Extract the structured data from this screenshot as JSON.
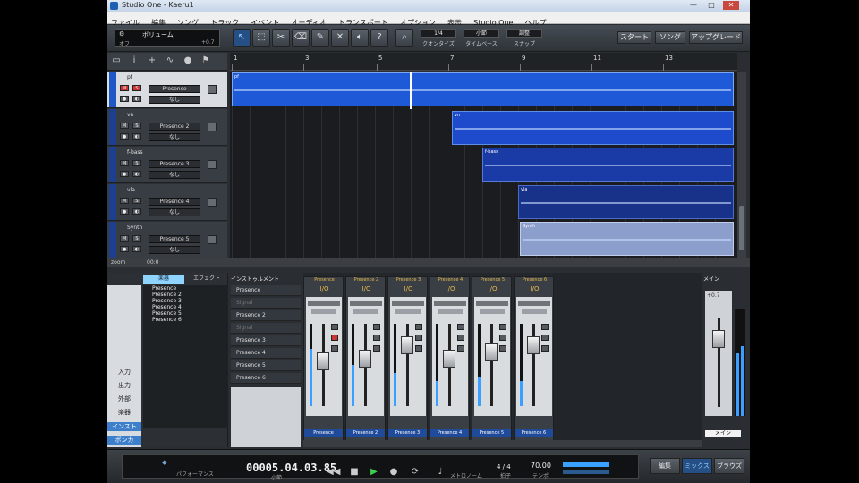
{
  "window": {
    "title": "Studio One - Kaeru1",
    "controls": [
      "—",
      "□",
      "✕"
    ]
  },
  "menu": [
    "ファイル",
    "編集",
    "ソング",
    "トラック",
    "イベント",
    "オーディオ",
    "トランスポート",
    "オプション",
    "表示",
    "Studio One",
    "ヘルプ"
  ],
  "toolbar": {
    "volume_label": "ボリューム",
    "volume_sub": "オフ",
    "volume_value": "+0.7",
    "tools": [
      "arrow-tool",
      "range-tool",
      "split-tool",
      "eraser-tool",
      "paint-tool",
      "mute-tool",
      "listen-tool",
      "help-tool",
      "zoom-tool"
    ],
    "grid": [
      {
        "value": "1/4",
        "label": "クオンタイズ"
      },
      {
        "value": "小節",
        "label": "タイムベース"
      },
      {
        "value": "調整",
        "label": "スナップ"
      }
    ],
    "start_label": "スタート",
    "song_label": "ソング",
    "upgrade_label": "アップグレード"
  },
  "ruler": {
    "bars": [
      "1",
      "3",
      "5",
      "7",
      "9",
      "11",
      "13"
    ]
  },
  "tracks": [
    {
      "name": "pf",
      "instrument": "Presence",
      "output": "なし",
      "selected": true
    },
    {
      "name": "vn",
      "instrument": "Presence 2",
      "output": "なし",
      "selected": false
    },
    {
      "name": "f-bass",
      "instrument": "Presence 3",
      "output": "なし",
      "selected": false
    },
    {
      "name": "vla",
      "instrument": "Presence 4",
      "output": "なし",
      "selected": false
    },
    {
      "name": "Synth",
      "instrument": "Presence 5",
      "output": "なし",
      "selected": false
    }
  ],
  "clips": [
    {
      "name": "pf"
    },
    {
      "name": "vn"
    },
    {
      "name": "f-bass"
    },
    {
      "name": "vla"
    },
    {
      "name": "Synth"
    }
  ],
  "arrange_bottom": {
    "zoom_label": "zoom",
    "info": "00:0"
  },
  "browser": {
    "tabs": [
      "楽器",
      "エフェクト"
    ],
    "side": [
      "入力",
      "出力",
      "外部",
      "楽器",
      "インスト",
      "ボンカ"
    ],
    "items": [
      "Presence",
      "Presence 2",
      "Presence 3",
      "Presence 4",
      "Presence 5",
      "Presence 6"
    ],
    "bottom_tabs": [
      "",
      "楽器",
      "ソ"
    ]
  },
  "instrument_list": {
    "header": "インストゥルメント",
    "rows": [
      {
        "label": "Presence",
        "ghost": false
      },
      {
        "label": "Signal",
        "ghost": true
      },
      {
        "label": "Presence 2",
        "ghost": false
      },
      {
        "label": "Signal",
        "ghost": true
      },
      {
        "label": "Presence 3",
        "ghost": false
      },
      {
        "label": "Presence 4",
        "ghost": false
      },
      {
        "label": "Presence 5",
        "ghost": false
      },
      {
        "label": "Presence 6",
        "ghost": false
      }
    ]
  },
  "mixer": {
    "channels": [
      {
        "name": "Presence",
        "io": "I/O",
        "label": "Presence",
        "fader": 0.55,
        "meter": 0.7
      },
      {
        "name": "Presence 2",
        "io": "I/O",
        "label": "Presence 2",
        "fader": 0.6,
        "meter": 0.5
      },
      {
        "name": "Presence 3",
        "io": "I/O",
        "label": "Presence 3",
        "fader": 0.8,
        "meter": 0.4
      },
      {
        "name": "Presence 4",
        "io": "I/O",
        "label": "Presence 4",
        "fader": 0.6,
        "meter": 0.3
      },
      {
        "name": "Presence 5",
        "io": "I/O",
        "label": "Presence 5",
        "fader": 0.7,
        "meter": 0.35
      },
      {
        "name": "Presence 6",
        "io": "I/O",
        "label": "Presence 6",
        "fader": 0.8,
        "meter": 0.3
      }
    ],
    "main": {
      "header": "メイン",
      "name": "メイン",
      "value": "+0.7"
    }
  },
  "transport": {
    "time": "00005.04.03.85",
    "time_unit": "小節",
    "perf_label": "パフォーマンス",
    "signature": "4 / 4",
    "signature_label": "拍子",
    "tempo": "70.00",
    "tempo_label": "テンポ",
    "metronome_label": "メトロノーム",
    "edit_label": "編集",
    "mix_label": "ミックス",
    "browse_label": "ブラウズ"
  },
  "colors": {
    "accent": "#1f57c7",
    "clip_dark": "#0f2f8a",
    "clip_grey": "#8c9fcc",
    "fader_green": "#3aa0ff"
  }
}
